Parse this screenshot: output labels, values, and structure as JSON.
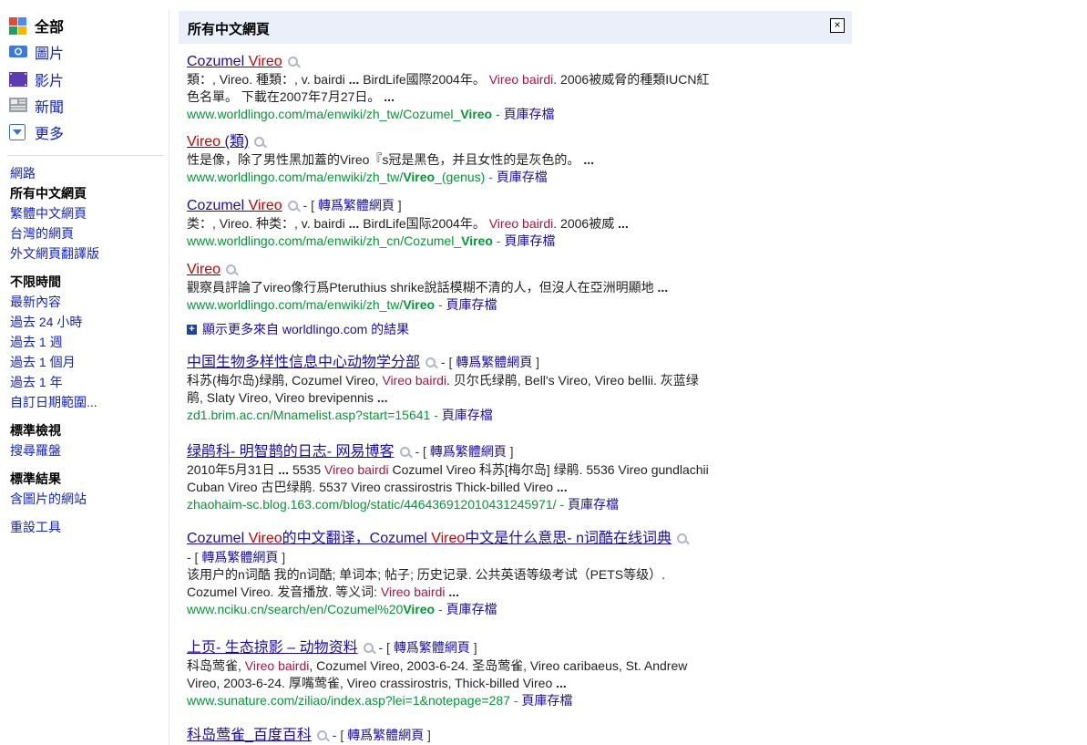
{
  "sidebar": {
    "modes": [
      {
        "label": "全部",
        "icon": "google-all-icon",
        "active": true
      },
      {
        "label": "圖片",
        "icon": "camera-icon",
        "active": false
      },
      {
        "label": "影片",
        "icon": "video-icon",
        "active": false
      },
      {
        "label": "新聞",
        "icon": "news-icon",
        "active": false
      },
      {
        "label": "更多",
        "icon": "chevron-down-icon",
        "active": false
      }
    ],
    "language": [
      "網路",
      "所有中文網頁",
      "繁體中文網頁",
      "台灣的網頁",
      "外文網頁翻譯版"
    ],
    "time_heading": "不限時間",
    "time": [
      "最新內容",
      "過去 24 小時",
      "過去 1 週",
      "過去 1 個月",
      "過去 1 年",
      "自訂日期範圍..."
    ],
    "view_heading": "標準檢視",
    "view_items": [
      "搜尋羅盤"
    ],
    "results_heading": "標準結果",
    "results_items": [
      "含圖片的網站"
    ],
    "reset": "重設工具"
  },
  "banner": {
    "title": "所有中文網頁",
    "close": "×"
  },
  "cache_label": "頁庫存檔",
  "translate_label": "轉爲繁體網頁",
  "more_from": "顯示更多來自 worldlingo.com 的結果",
  "results": [
    {
      "title_parts": [
        {
          "t": "Cozumel ",
          "h": false
        },
        {
          "t": "Vireo",
          "h": true
        }
      ],
      "translate": false,
      "snippet_html": "類：, Vireo. 種類：, v. bairdi <b>...</b> BirdLife國際2004年。 <span class=\"hl\">Vireo bairdi</span>. 2006被威脅的種類IUCN紅<br>色名單。 下載在2007年7月27日。 <b>...</b>",
      "url_html": "www.worldlingo.com/ma/enwiki/zh_tw/Cozumel_<b>Vireo</b>"
    },
    {
      "title_parts": [
        {
          "t": "Vireo",
          "h": true
        },
        {
          "t": " (類)",
          "h": false
        }
      ],
      "translate": false,
      "snippet_html": "性是像，除了男性黑加蓋的Vireo『s冠是黑色，并且女性的是灰色的。 <b>...</b>",
      "url_html": "www.worldlingo.com/ma/enwiki/zh_tw/<b>Vireo</b>_(genus)"
    },
    {
      "title_parts": [
        {
          "t": "Cozumel ",
          "h": false
        },
        {
          "t": "Vireo",
          "h": true
        }
      ],
      "translate": true,
      "snippet_html": "类：, Vireo. 种类：, v. bairdi <b>...</b> BirdLife国际2004年。 <span class=\"hl\">Vireo bairdi</span>. 2006被威 <b>...</b>",
      "url_html": "www.worldlingo.com/ma/enwiki/zh_cn/Cozumel_<b>Vireo</b>"
    },
    {
      "title_parts": [
        {
          "t": "Vireo",
          "h": true
        }
      ],
      "translate": false,
      "snippet_html": "觀察員評論了vireo像行爲Pteruthius shrike說話模糊不清的人，但沒人在亞洲明顯地 <b>...</b>",
      "url_html": "www.worldlingo.com/ma/enwiki/zh_tw/<b>Vireo</b>"
    },
    {
      "title_parts": [
        {
          "t": "中国生物多样性信息中心动物学分部",
          "h": false
        }
      ],
      "translate": true,
      "snippet_html": "科苏(梅尔岛)绿鹃, Cozumel Vireo, <span class=\"hl\">Vireo bairdi</span>. 贝尔氏绿鹃, Bell's Vireo, Vireo bellii. 灰蓝绿<br>鹃, Slaty Vireo, Vireo brevipennis <b>...</b>",
      "url_html": "zd1.brim.ac.cn/Mnamelist.asp?start=15641"
    },
    {
      "title_parts": [
        {
          "t": "绿鹃科- 明智鹊的日志- 网易博客",
          "h": false
        }
      ],
      "translate": true,
      "snippet_html": "2010年5月31日 <b>...</b> 5535 <span class=\"hl\">Vireo bairdi</span> Cozumel Vireo 科苏[梅尔岛] 绿鹃. 5536 Vireo gundlachii<br>Cuban Vireo 古巴绿鹃. 5537 Vireo crassirostris Thick-billed Vireo <b>...</b>",
      "url_html": "zhaohaim-sc.blog.163.com/blog/static/446436912010431245971/"
    },
    {
      "title_parts": [
        {
          "t": "Cozumel ",
          "h": false
        },
        {
          "t": "Vireo",
          "h": true
        },
        {
          "t": "的中文翻译，Cozumel ",
          "h": false
        },
        {
          "t": "Vireo",
          "h": true
        },
        {
          "t": "中文是什么意思- n词酷在线词典",
          "h": false
        }
      ],
      "translate": true,
      "snippet_html": "该用户的n词酷 我的n词酷; 单词本; 帖子; 历史记录. 公共英语等级考试（PETS等级）.<br>Cozumel Vireo. 发音播放. 等义词: <span class=\"hl\">Vireo bairdi</span> <b>...</b>",
      "url_html": "www.nciku.cn/search/en/Cozumel%20<b>Vireo</b>"
    },
    {
      "title_parts": [
        {
          "t": "上页- 生态掠影 – 动物资料",
          "h": false
        }
      ],
      "translate": true,
      "snippet_html": "科岛莺雀, <span class=\"hl\">Vireo bairdi</span>, Cozumel Vireo, 2003-6-24. 圣岛莺雀, Vireo caribaeus, St. Andrew<br>Vireo, 2003-6-24. 厚嘴莺雀, Vireo crassirostris, Thick-billed Vireo <b>...</b>",
      "url_html": "www.sunature.com/ziliao/index.asp?lei=1&amp;notepage=287"
    },
    {
      "title_parts": [
        {
          "t": "科岛莺雀_百度百科",
          "h": false
        }
      ],
      "translate": true,
      "snippet_html": "",
      "url_html": ""
    }
  ]
}
